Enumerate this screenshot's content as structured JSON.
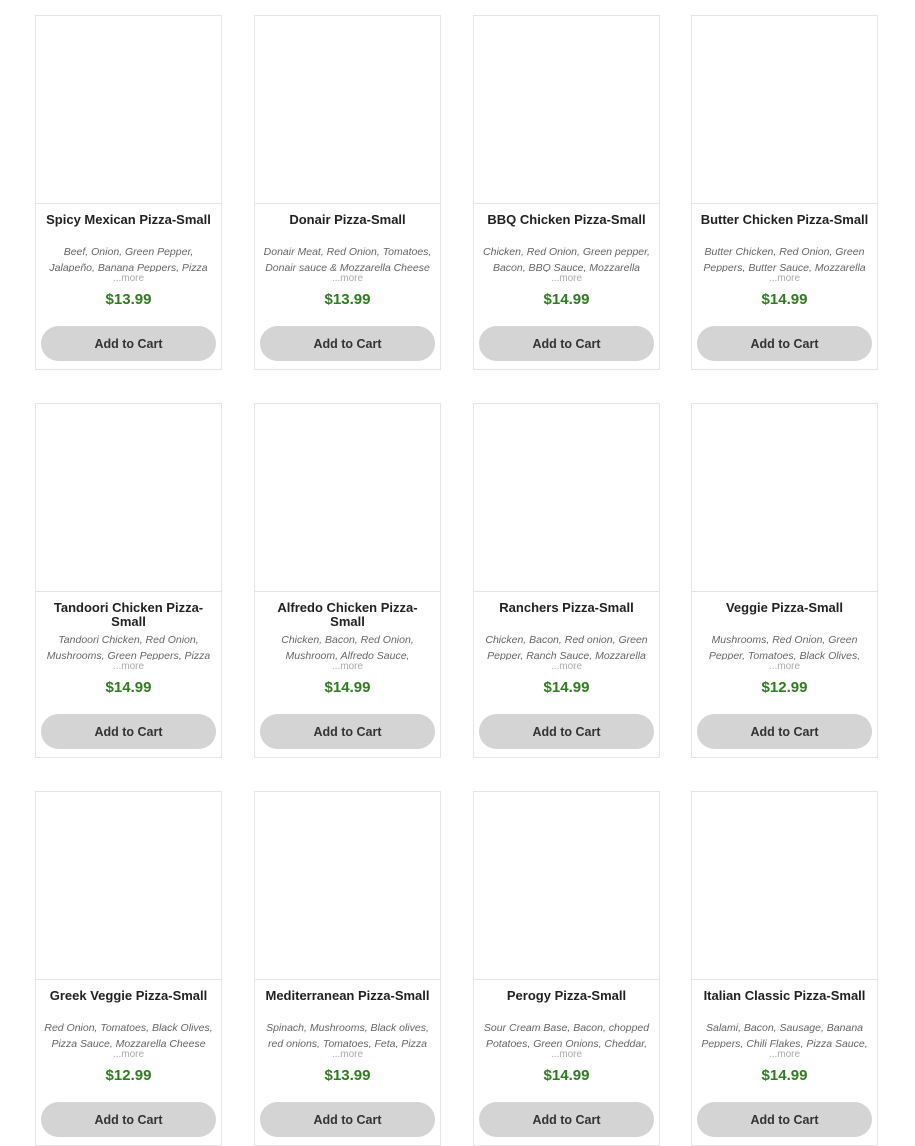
{
  "products": [
    {
      "name": "Spicy Mexican Pizza-Small",
      "description": "Beef, Onion, Green Pepper, Jalapeño, Banana Peppers, Pizza",
      "more": "...more",
      "price": "$13.99",
      "button": "Add to Cart"
    },
    {
      "name": "Donair Pizza-Small",
      "description": "Donair Meat, Red Onion, Tomatoes, Donair sauce & Mozzarella Cheese",
      "more": "...more",
      "price": "$13.99",
      "button": "Add to Cart"
    },
    {
      "name": "BBQ Chicken Pizza-Small",
      "description": "Chicken, Red Onion, Green pepper, Bacon, BBQ Sauce, Mozzarella",
      "more": "...more",
      "price": "$14.99",
      "button": "Add to Cart"
    },
    {
      "name": "Butter Chicken Pizza-Small",
      "description": "Butter Chicken, Red Onion, Green Peppers, Butter Sauce, Mozzarella",
      "more": "...more",
      "price": "$14.99",
      "button": "Add to Cart"
    },
    {
      "name": "Tandoori Chicken Pizza-Small",
      "description": "Tandoori Chicken, Red Onion, Mushrooms, Green Peppers, Pizza",
      "more": "...more",
      "price": "$14.99",
      "button": "Add to Cart"
    },
    {
      "name": "Alfredo Chicken Pizza-Small",
      "description": "Chicken, Bacon, Red Onion, Mushroom, Alfredo Sauce,",
      "more": "...more",
      "price": "$14.99",
      "button": "Add to Cart"
    },
    {
      "name": "Ranchers Pizza-Small",
      "description": "Chicken, Bacon, Red onion, Green Pepper, Ranch Sauce, Mozzarella",
      "more": "...more",
      "price": "$14.99",
      "button": "Add to Cart"
    },
    {
      "name": "Veggie Pizza-Small",
      "description": "Mushrooms, Red Onion, Green Pepper, Tomatoes, Black Olives,",
      "more": "...more",
      "price": "$12.99",
      "button": "Add to Cart"
    },
    {
      "name": "Greek Veggie Pizza-Small",
      "description": "Red Onion, Tomatoes, Black Olives, Pizza Sauce, Mozzarella Cheese",
      "more": "...more",
      "price": "$12.99",
      "button": "Add to Cart"
    },
    {
      "name": "Mediterranean Pizza-Small",
      "description": "Spinach, Mushrooms, Black olives, red onions, Tomatoes, Feta, Pizza",
      "more": "...more",
      "price": "$13.99",
      "button": "Add to Cart"
    },
    {
      "name": "Perogy Pizza-Small",
      "description": "Sour Cream Base, Bacon, chopped Potatoes, Green Onions, Cheddar,",
      "more": "...more",
      "price": "$14.99",
      "button": "Add to Cart"
    },
    {
      "name": "Italian Classic Pizza-Small",
      "description": "Salami, Bacon, Sausage, Banana Peppers, Chili Flakes, Pizza Sauce,",
      "more": "...more",
      "price": "$14.99",
      "button": "Add to Cart"
    }
  ],
  "colors": {
    "price": "#2e7d1e",
    "button_bg": "#d4d4d4",
    "border": "#e5e5e5"
  }
}
